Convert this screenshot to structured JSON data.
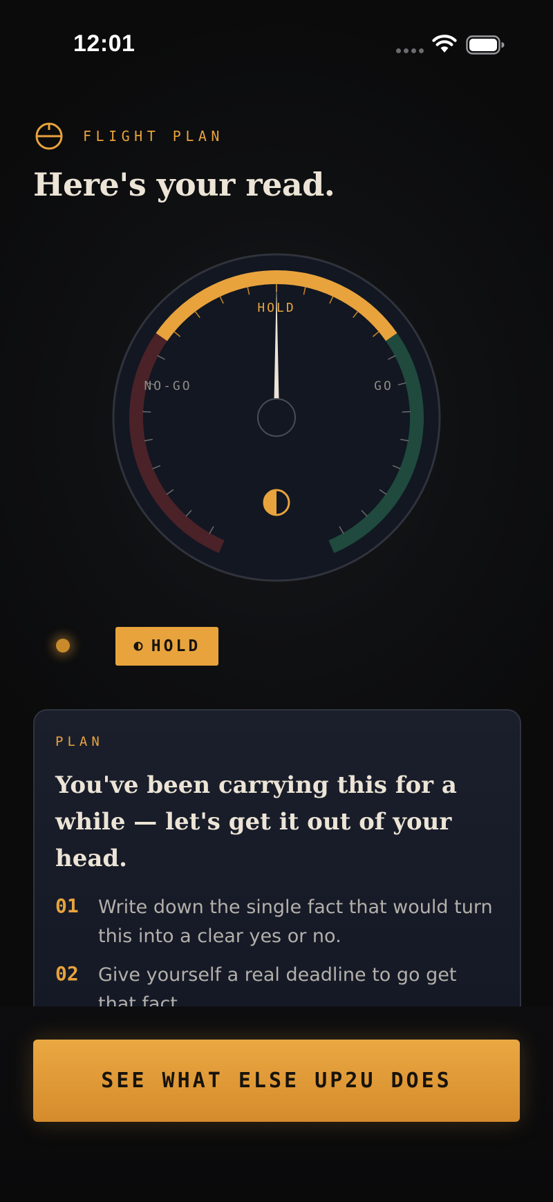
{
  "status_bar": {
    "time": "12:01",
    "icons": [
      "cellular-signal-icon",
      "wifi-icon",
      "battery-icon"
    ]
  },
  "header": {
    "icon": "flight-plan-icon",
    "label": "FLIGHT PLAN",
    "title": "Here's your read."
  },
  "gauge": {
    "labels": {
      "left": "NO-GO",
      "top": "HOLD",
      "right": "GO"
    },
    "reading": 0.5,
    "center_icon": "half-moon-icon",
    "colors": {
      "nogo": "#4a2228",
      "hold": "#e8a33d",
      "go": "#1f4a3d",
      "face": "#121722"
    }
  },
  "status": {
    "pill_icon": "half-moon-icon",
    "pill_label": "HOLD"
  },
  "plan": {
    "label": "PLAN",
    "heading": "You've been carrying this for a while — let's get it out of your head.",
    "steps": [
      {
        "number": "01",
        "text": "Write down the single fact that would turn this into a clear yes or no."
      },
      {
        "number": "02",
        "text": "Give yourself a real deadline to go get that fact."
      }
    ]
  },
  "cta": {
    "label": "SEE WHAT ELSE UP2U DOES"
  },
  "colors": {
    "accent": "#e8a33d",
    "background": "#0b0b0c",
    "text": "#ece4d6",
    "muted": "#b3b0aa"
  }
}
